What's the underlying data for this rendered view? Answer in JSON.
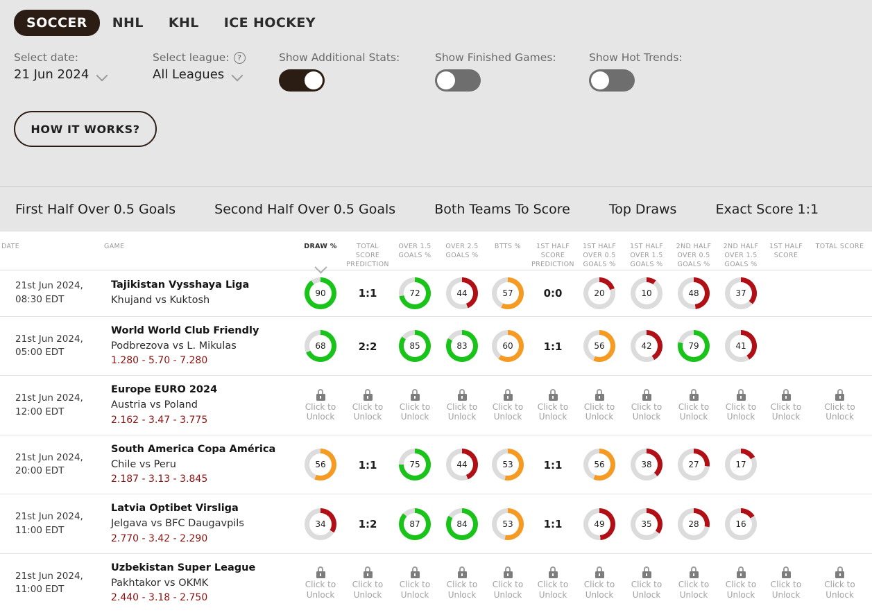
{
  "sports": [
    {
      "label": "SOCCER",
      "active": true
    },
    {
      "label": "NHL",
      "active": false
    },
    {
      "label": "KHL",
      "active": false
    },
    {
      "label": "ICE HOCKEY",
      "active": false
    }
  ],
  "controls": {
    "date": {
      "label": "Select date:",
      "value": "21 Jun 2024"
    },
    "league": {
      "label": "Select league:",
      "value": "All Leagues",
      "help_icon": "question-mark-icon"
    },
    "additional_stats": {
      "label": "Show Additional Stats:",
      "on": true
    },
    "finished_games": {
      "label": "Show Finished Games:",
      "on": false
    },
    "hot_trends": {
      "label": "Show Hot Trends:",
      "on": false
    },
    "how_it_works": "HOW IT WORKS?"
  },
  "markets": [
    "First Half Over 0.5 Goals",
    "Second Half Over 0.5 Goals",
    "Both Teams To Score",
    "Top Draws",
    "Exact Score 1:1"
  ],
  "table": {
    "headers": {
      "date": "DATE",
      "game": "GAME",
      "draw": "DRAW %",
      "total_score_prediction": "TOTAL SCORE PREDICTION",
      "over15": "OVER 1.5 GOALS %",
      "over25": "OVER 2.5 GOALS %",
      "btts": "BTTS %",
      "first_half_score_prediction": "1ST HALF SCORE PREDICTION",
      "h1_over05": "1ST HALF OVER 0.5 GOALS %",
      "h1_over15": "1ST HALF OVER 1.5 GOALS %",
      "h2_over05": "2ND HALF OVER 0.5 GOALS %",
      "h2_over15": "2ND HALF OVER 1.5 GOALS %",
      "h1_score": "1ST HALF SCORE",
      "total_score": "TOTAL SCORE"
    },
    "locked_label_line1": "Click to",
    "locked_label_line2": "Unlock",
    "rows": [
      {
        "date_line1": "21st Jun 2024,",
        "date_line2": "08:30 EDT",
        "league": "Tajikistan Vysshaya Liga",
        "teams": "Khujand vs Kuktosh",
        "odds": "",
        "locked": false,
        "draw": 90,
        "total_score_prediction": "1:1",
        "over15": 72,
        "over25": 44,
        "btts": 57,
        "first_half_score_prediction": "0:0",
        "h1_over05": 20,
        "h1_over15": 10,
        "h2_over05": 48,
        "h2_over15": 37,
        "h1_score": "",
        "total_score": ""
      },
      {
        "date_line1": "21st Jun 2024,",
        "date_line2": "05:00 EDT",
        "league": "World World Club Friendly",
        "teams": "Podbrezova vs L. Mikulas",
        "odds": "1.280 - 5.70 - 7.280",
        "locked": false,
        "draw": 68,
        "total_score_prediction": "2:2",
        "over15": 85,
        "over25": 83,
        "btts": 60,
        "first_half_score_prediction": "1:1",
        "h1_over05": 56,
        "h1_over15": 42,
        "h2_over05": 79,
        "h2_over15": 41,
        "h1_score": "",
        "total_score": ""
      },
      {
        "date_line1": "21st Jun 2024,",
        "date_line2": "12:00 EDT",
        "league": "Europe EURO 2024",
        "teams": "Austria vs Poland",
        "odds": "2.162 - 3.47 - 3.775",
        "locked": true
      },
      {
        "date_line1": "21st Jun 2024,",
        "date_line2": "20:00 EDT",
        "league": "South America Copa América",
        "teams": "Chile vs Peru",
        "odds": "2.187 - 3.13 - 3.845",
        "locked": false,
        "draw": 56,
        "total_score_prediction": "1:1",
        "over15": 75,
        "over25": 44,
        "btts": 53,
        "first_half_score_prediction": "1:1",
        "h1_over05": 56,
        "h1_over15": 38,
        "h2_over05": 27,
        "h2_over15": 17,
        "h1_score": "",
        "total_score": ""
      },
      {
        "date_line1": "21st Jun 2024,",
        "date_line2": "11:00 EDT",
        "league": "Latvia Optibet Virsliga",
        "teams": "Jelgava vs BFC Daugavpils",
        "odds": "2.770 - 3.42 - 2.290",
        "locked": false,
        "draw": 34,
        "total_score_prediction": "1:2",
        "over15": 87,
        "over25": 84,
        "btts": 53,
        "first_half_score_prediction": "1:1",
        "h1_over05": 49,
        "h1_over15": 35,
        "h2_over05": 28,
        "h2_over15": 16,
        "h1_score": "",
        "total_score": ""
      },
      {
        "date_line1": "21st Jun 2024,",
        "date_line2": "11:00 EDT",
        "league": "Uzbekistan Super League",
        "teams": "Pakhtakor vs OKMK",
        "odds": "2.440 - 3.18 - 2.750",
        "locked": true
      }
    ]
  },
  "colors": {
    "accent_dark": "#2b1d14",
    "green": "#19c319",
    "orange": "#f59a23",
    "red": "#b00f15",
    "track": "#dcdcdc",
    "odds": "#8c1111",
    "page_bg": "#e6e6e6"
  }
}
